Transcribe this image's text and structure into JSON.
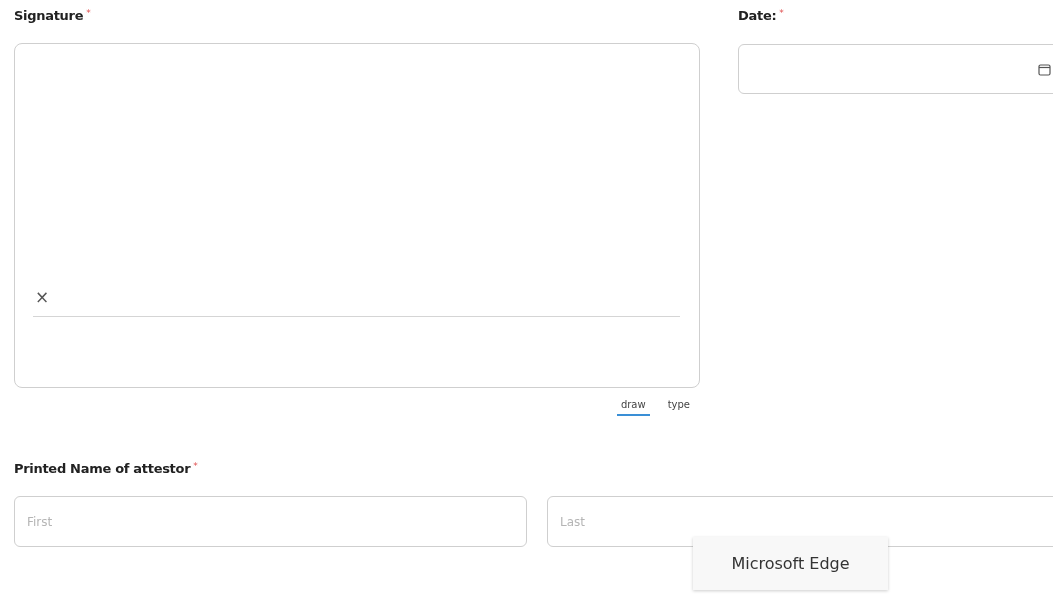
{
  "signature": {
    "label": "Signature",
    "required_mark": "*",
    "clear_symbol": "×",
    "tabs": [
      {
        "label": "draw",
        "selected": true
      },
      {
        "label": "type",
        "selected": false
      }
    ]
  },
  "date": {
    "label": "Date:",
    "required_mark": "*"
  },
  "printed_name": {
    "label": "Printed Name of attestor",
    "required_mark": "*",
    "fields": [
      {
        "placeholder": "First"
      },
      {
        "placeholder": "Last"
      }
    ]
  },
  "tooltip": {
    "text": "Microsoft Edge"
  }
}
